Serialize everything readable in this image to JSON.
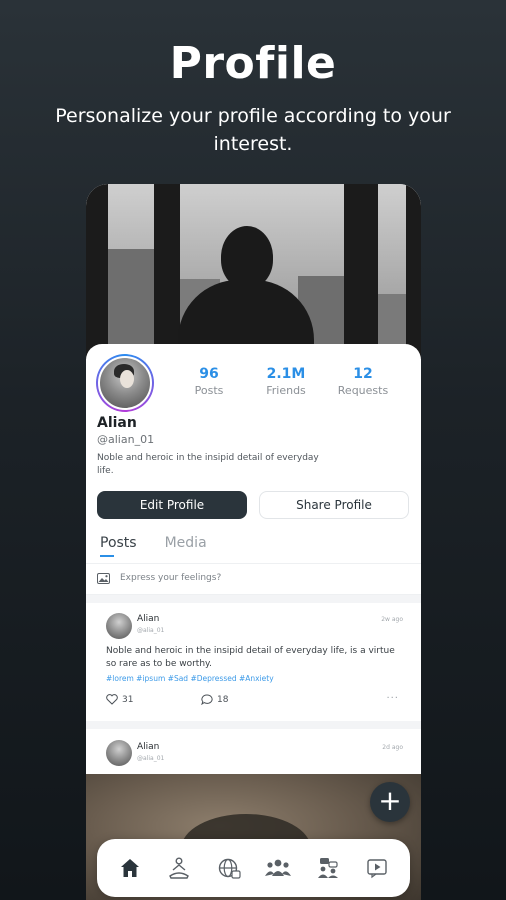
{
  "hero": {
    "title": "Profile",
    "subtitle": "Personalize your profile according to your interest."
  },
  "profile": {
    "stats": [
      {
        "value": "96",
        "label": "Posts"
      },
      {
        "value": "2.1M",
        "label": "Friends"
      },
      {
        "value": "12",
        "label": "Requests"
      }
    ],
    "name": "Alian",
    "handle": "@alian_01",
    "bio": "Noble and heroic in the insipid detail of everyday life.",
    "edit_label": "Edit Profile",
    "share_label": "Share Profile"
  },
  "tabs": [
    {
      "label": "Posts",
      "active": true
    },
    {
      "label": "Media",
      "active": false
    }
  ],
  "compose": {
    "placeholder": "Express your feelings?",
    "icon": "image-icon"
  },
  "posts": [
    {
      "author": "Alian",
      "handle": "@alia_01",
      "time": "2w ago",
      "text": "Noble and heroic in the insipid detail of everyday life, is a virtue so rare as to be worthy.",
      "tags": "#lorem #ipsum #Sad #Depressed #Anxiety",
      "likes": "31",
      "comments": "18"
    },
    {
      "author": "Alian",
      "handle": "@alia_01",
      "time": "2d ago"
    }
  ],
  "fab": {
    "label": "+"
  },
  "nav": [
    {
      "icon": "home-icon",
      "active": true
    },
    {
      "icon": "meditation-icon"
    },
    {
      "icon": "globe-icon"
    },
    {
      "icon": "community-icon"
    },
    {
      "icon": "discussion-icon"
    },
    {
      "icon": "video-icon"
    }
  ],
  "colors": {
    "accent": "#2b8fe6",
    "dark": "#2a343b",
    "tag": "#3e9be8"
  }
}
